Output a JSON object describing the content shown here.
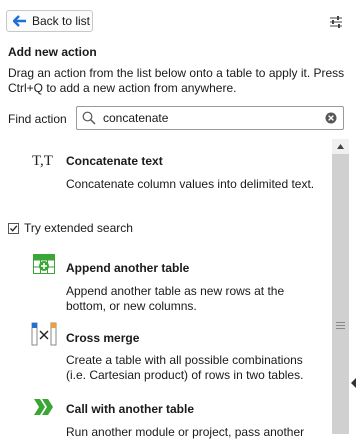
{
  "header": {
    "back_label": "Back to list"
  },
  "panel": {
    "heading": "Add new action",
    "description": "Drag an action from the list below onto a table to apply it. Press Ctrl+Q to add a new action from anywhere."
  },
  "search": {
    "label": "Find action",
    "value": "concatenate"
  },
  "results": [
    {
      "icon": "concatenate-text-icon",
      "title": "Concatenate text",
      "description": "Concatenate column values into delimited text."
    }
  ],
  "extended_search": {
    "label": "Try extended search",
    "checked": true
  },
  "extended_results": [
    {
      "icon": "append-table-icon",
      "title": "Append another table",
      "description": "Append another table as new rows at the bottom, or new columns."
    },
    {
      "icon": "cross-merge-icon",
      "title": "Cross merge",
      "description": "Create a table with all possible combinations (i.e. Cartesian product) of rows in two tables."
    },
    {
      "icon": "call-with-table-icon",
      "title": "Call with another table",
      "description": "Run another module or project, pass another"
    }
  ],
  "colors": {
    "accent": "#1e6fd9",
    "green": "#3aa635",
    "scrollbar_thumb": "#d0d0d0"
  }
}
